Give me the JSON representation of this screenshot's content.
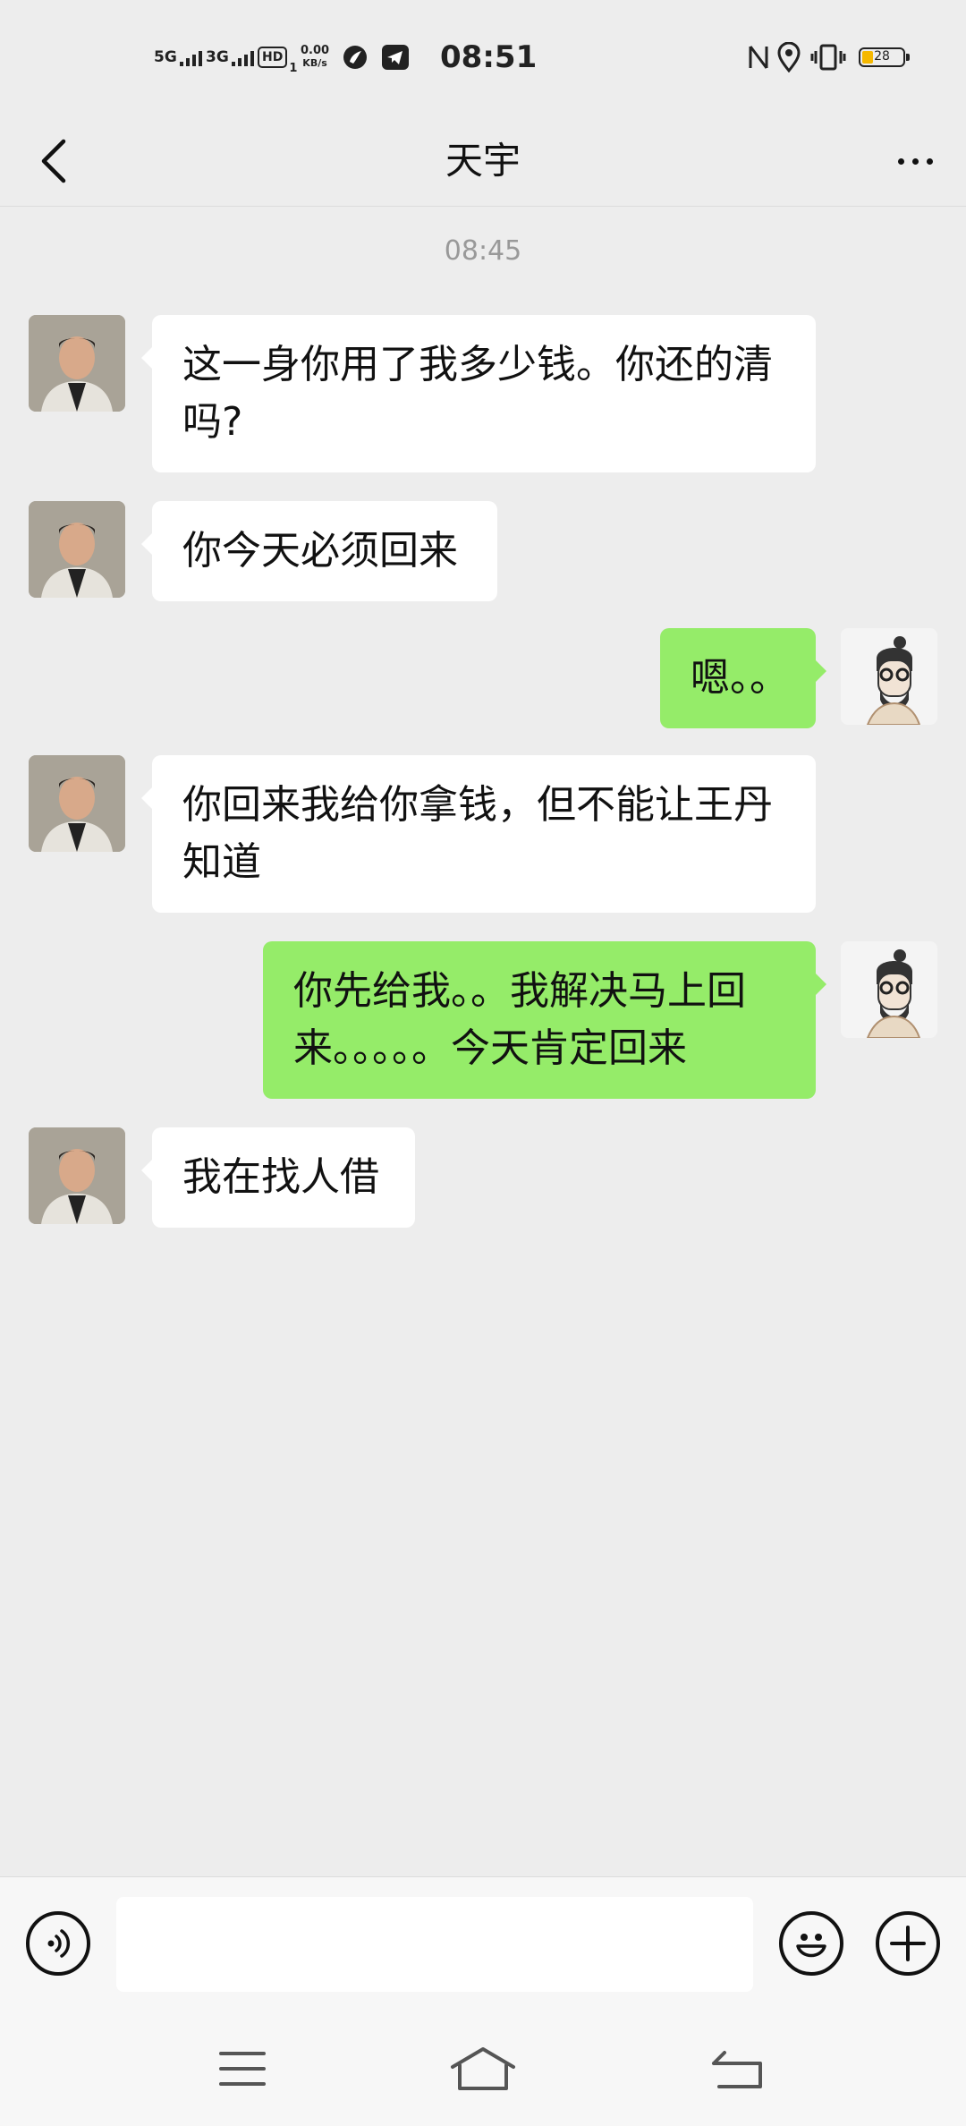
{
  "status_bar": {
    "signal1_label": "5G",
    "signal2_label": "3G",
    "hd_label": "HD",
    "hd_sub": "1",
    "net_speed_value": "0.00",
    "net_speed_unit": "KB/s",
    "time": "08:51",
    "battery_level": "28",
    "battery_fraction": 0.28
  },
  "header": {
    "title": "天宇"
  },
  "chat": {
    "timestamp": "08:45",
    "messages": [
      {
        "direction": "in",
        "avatar": "contact-avatar",
        "text": "这一身你用了我多少钱。你还的清吗?"
      },
      {
        "direction": "in",
        "avatar": "contact-avatar",
        "text": "你今天必须回来"
      },
      {
        "direction": "out",
        "avatar": "self-avatar",
        "text": "嗯。。"
      },
      {
        "direction": "in",
        "avatar": "contact-avatar",
        "text": "你回来我给你拿钱，但不能让王丹知道"
      },
      {
        "direction": "out",
        "avatar": "self-avatar",
        "text": "你先给我。。我解决马上回来。。。。。今天肯定回来"
      },
      {
        "direction": "in",
        "avatar": "contact-avatar",
        "text": "我在找人借"
      }
    ]
  },
  "input_bar": {
    "voice_icon": "voice-icon",
    "emoji_icon": "emoji-icon",
    "plus_icon": "plus-icon",
    "input_value": ""
  },
  "nav_bar": {
    "menu_icon": "menu-icon",
    "home_icon": "home-icon",
    "back_icon": "back-icon"
  },
  "colors": {
    "background": "#ededed",
    "incoming_bubble": "#ffffff",
    "outgoing_bubble": "#95ec69",
    "battery_fill": "#f5b800"
  }
}
